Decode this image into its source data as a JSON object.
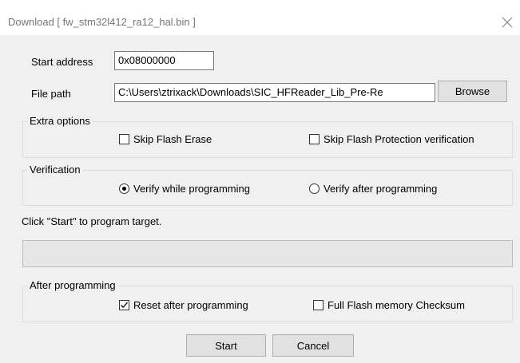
{
  "window": {
    "title": "Download [ fw_stm32l412_ra12_hal.bin ]"
  },
  "fields": {
    "start_address_label": "Start address",
    "start_address_value": "0x08000000",
    "file_path_label": "File path",
    "file_path_value": "C:\\Users\\ztrixack\\Downloads\\SIC_HFReader_Lib_Pre-Re",
    "browse_label": "Browse"
  },
  "extra_options": {
    "title": "Extra options",
    "skip_flash_erase": {
      "label": "Skip Flash Erase",
      "checked": false
    },
    "skip_protection": {
      "label": "Skip Flash Protection verification",
      "checked": false
    }
  },
  "verification": {
    "title": "Verification",
    "verify_while": {
      "label": "Verify while programming",
      "selected": true
    },
    "verify_after": {
      "label": "Verify after programming",
      "selected": false
    }
  },
  "status": {
    "message": "Click \"Start\" to program target.",
    "progress": 0
  },
  "after_programming": {
    "title": "After programming",
    "reset_after": {
      "label": "Reset after programming",
      "checked": true
    },
    "full_checksum": {
      "label": "Full Flash memory Checksum",
      "checked": false
    }
  },
  "buttons": {
    "start": "Start",
    "cancel": "Cancel"
  }
}
